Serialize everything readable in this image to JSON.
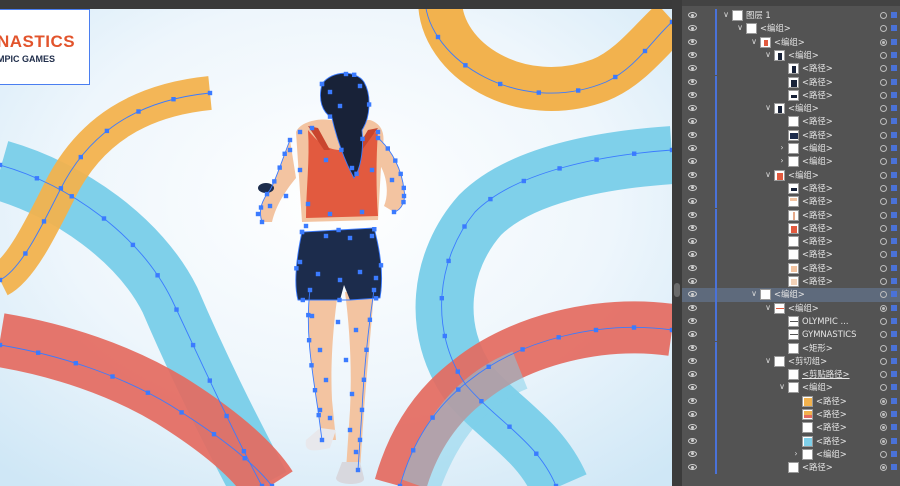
{
  "poster": {
    "title": "NASTICS",
    "subtitle": "MPIC GAMES"
  },
  "colors": {
    "accent": "#4a72d8",
    "anchor": "#3b7bff",
    "ribbon_blue": "#7fd0ea",
    "ribbon_orange": "#f2b24e",
    "ribbon_red": "#e46a5f",
    "shorts": "#1c2c4c",
    "tank_top": "#e25a3f",
    "skin": "#f3c4a1"
  },
  "layers": {
    "rows": [
      {
        "depth": 0,
        "twisty": "v",
        "name": "图层 1",
        "thumb": "layer",
        "target": "open",
        "selected": false
      },
      {
        "depth": 1,
        "twisty": "v",
        "name": "<编组>",
        "thumb": "group",
        "target": "open",
        "selected": false
      },
      {
        "depth": 2,
        "twisty": "v",
        "name": "<编组>",
        "thumb": "figure",
        "target": "filled",
        "selected": false
      },
      {
        "depth": 3,
        "twisty": "v",
        "name": "<编组>",
        "thumb": "dark",
        "target": "open",
        "selected": false
      },
      {
        "depth": 4,
        "twisty": "",
        "name": "<路径>",
        "thumb": "dark",
        "target": "open",
        "selected": false
      },
      {
        "depth": 4,
        "twisty": "",
        "name": "<路径>",
        "thumb": "dark-blob",
        "target": "open",
        "selected": false
      },
      {
        "depth": 4,
        "twisty": "",
        "name": "<路径>",
        "thumb": "dark-small",
        "target": "open",
        "selected": false
      },
      {
        "depth": 3,
        "twisty": "v",
        "name": "<编组>",
        "thumb": "dark",
        "target": "open",
        "selected": false
      },
      {
        "depth": 4,
        "twisty": "",
        "name": "<路径>",
        "thumb": "white",
        "target": "open",
        "selected": false
      },
      {
        "depth": 4,
        "twisty": "",
        "name": "<路径>",
        "thumb": "navy",
        "target": "open",
        "selected": false
      },
      {
        "depth": 4,
        "twisty": ">",
        "name": "<编组>",
        "thumb": "white",
        "target": "open",
        "selected": false
      },
      {
        "depth": 4,
        "twisty": ">",
        "name": "<编组>",
        "thumb": "white",
        "target": "open",
        "selected": false
      },
      {
        "depth": 3,
        "twisty": "v",
        "name": "<编组>",
        "thumb": "red",
        "target": "open",
        "selected": false
      },
      {
        "depth": 4,
        "twisty": "",
        "name": "<路径>",
        "thumb": "dark-small",
        "target": "open",
        "selected": false
      },
      {
        "depth": 4,
        "twisty": "",
        "name": "<路径>",
        "thumb": "skin-stroke",
        "target": "open",
        "selected": false
      },
      {
        "depth": 4,
        "twisty": "",
        "name": "<路径>",
        "thumb": "skin-line",
        "target": "open",
        "selected": false
      },
      {
        "depth": 4,
        "twisty": "",
        "name": "<路径>",
        "thumb": "red",
        "target": "open",
        "selected": false
      },
      {
        "depth": 4,
        "twisty": "",
        "name": "<路径>",
        "thumb": "white",
        "target": "open",
        "selected": false
      },
      {
        "depth": 4,
        "twisty": "",
        "name": "<路径>",
        "thumb": "white",
        "target": "open",
        "selected": false
      },
      {
        "depth": 4,
        "twisty": "",
        "name": "<路径>",
        "thumb": "skin",
        "target": "open",
        "selected": false
      },
      {
        "depth": 4,
        "twisty": "",
        "name": "<路径>",
        "thumb": "skin-light",
        "target": "open",
        "selected": false
      },
      {
        "depth": 2,
        "twisty": "v",
        "name": "<编组>",
        "thumb": "group",
        "target": "open",
        "selected": true
      },
      {
        "depth": 3,
        "twisty": "v",
        "name": "<编组>",
        "thumb": "red-line",
        "target": "filled",
        "selected": false
      },
      {
        "depth": 4,
        "twisty": "",
        "name": "OLYMPIC ...",
        "thumb": "text",
        "target": "open",
        "selected": false
      },
      {
        "depth": 4,
        "twisty": "",
        "name": "GYMNASTICS",
        "thumb": "text",
        "target": "open",
        "selected": false
      },
      {
        "depth": 4,
        "twisty": "",
        "name": "<矩形>",
        "thumb": "white",
        "target": "open",
        "selected": false
      },
      {
        "depth": 3,
        "twisty": "v",
        "name": "<剪切组>",
        "thumb": "group",
        "target": "open",
        "selected": false
      },
      {
        "depth": 4,
        "twisty": "",
        "name": "<剪贴路径>",
        "thumb": "white",
        "target": "open",
        "selected": false,
        "underline": true
      },
      {
        "depth": 4,
        "twisty": "v",
        "name": "<编组>",
        "thumb": "group",
        "target": "open",
        "selected": false
      },
      {
        "depth": 5,
        "twisty": "",
        "name": "<路径>",
        "thumb": "orange",
        "target": "filled",
        "selected": false
      },
      {
        "depth": 5,
        "twisty": "",
        "name": "<路径>",
        "thumb": "orange-red",
        "target": "filled",
        "selected": false
      },
      {
        "depth": 5,
        "twisty": "",
        "name": "<路径>",
        "thumb": "white",
        "target": "filled",
        "selected": false
      },
      {
        "depth": 5,
        "twisty": "",
        "name": "<路径>",
        "thumb": "blue",
        "target": "filled",
        "selected": false
      },
      {
        "depth": 5,
        "twisty": ">",
        "name": "<编组>",
        "thumb": "white",
        "target": "open",
        "selected": false
      },
      {
        "depth": 4,
        "twisty": "",
        "name": "<路径>",
        "thumb": "white",
        "target": "filled",
        "selected": false
      }
    ]
  }
}
